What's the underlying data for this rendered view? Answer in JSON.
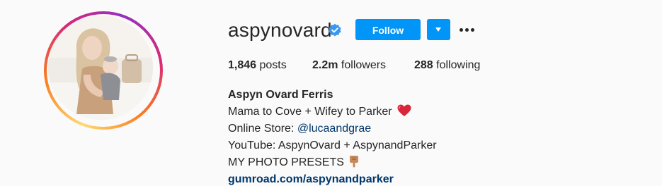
{
  "profile": {
    "username": "aspynovard",
    "verified": true,
    "follow_label": "Follow",
    "posts_count": "1,846",
    "posts_label": "posts",
    "followers_count": "2.2m",
    "followers_label": "followers",
    "following_count": "288",
    "following_label": "following"
  },
  "bio": {
    "full_name": "Aspyn Ovard Ferris",
    "line1": "Mama to Cove + Wifey to Parker",
    "line1_emoji": "heart-emoji",
    "line2_prefix": "Online Store: ",
    "line2_mention": "@lucaandgrae",
    "line3": "YouTube: AspynOvard + AspynandParker",
    "line4": "MY PHOTO PRESETS",
    "line4_emoji": "pointing-down-emoji",
    "website": "gumroad.com/aspynandparker"
  },
  "icons": {
    "verified": "verified-badge-icon",
    "dropdown": "chevron-down-icon",
    "more": "more-options-icon"
  },
  "colors": {
    "accent": "#0095f6",
    "link": "#00376b",
    "text": "#262626",
    "background": "#fafafa"
  }
}
